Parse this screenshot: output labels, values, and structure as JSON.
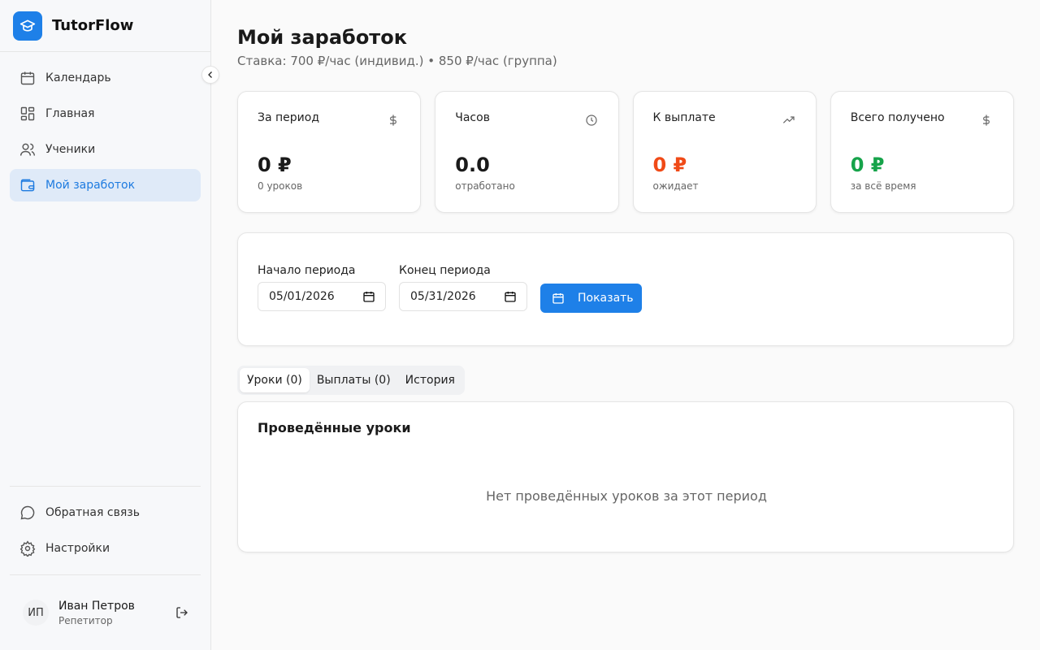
{
  "app": {
    "name": "TutorFlow",
    "brand_color": "#1e80e8"
  },
  "sidebar": {
    "items": [
      {
        "label": "Календарь",
        "icon": "calendar-icon",
        "active": false
      },
      {
        "label": "Главная",
        "icon": "dashboard-icon",
        "active": false
      },
      {
        "label": "Ученики",
        "icon": "users-icon",
        "active": false
      },
      {
        "label": "Мой заработок",
        "icon": "wallet-icon",
        "active": true
      }
    ],
    "bottom_items": [
      {
        "label": "Обратная связь",
        "icon": "message-icon"
      },
      {
        "label": "Настройки",
        "icon": "gear-icon"
      }
    ],
    "user": {
      "initials": "ИП",
      "name": "Иван Петров",
      "role": "Репетитор"
    }
  },
  "header": {
    "title": "Мой заработок",
    "subtitle": "Ставка: 700 ₽/час (индивид.) • 850 ₽/час (группа)"
  },
  "stats": [
    {
      "label": "За период",
      "icon": "dollar-icon",
      "value": "0 ₽",
      "note": "0 уроков",
      "color": "#1a1a1a"
    },
    {
      "label": "Часов",
      "icon": "clock-icon",
      "value": "0.0",
      "note": "отработано",
      "color": "#1a1a1a"
    },
    {
      "label": "К выплате",
      "icon": "trending-up-icon",
      "value": "0 ₽",
      "note": "ожидает",
      "color": "#f04a17"
    },
    {
      "label": "Всего получено",
      "icon": "dollar-icon",
      "value": "0 ₽",
      "note": "за всё время",
      "color": "#16a34a"
    }
  ],
  "filter": {
    "start_label": "Начало периода",
    "start_value": "05/01/2026",
    "end_label": "Конец периода",
    "end_value": "05/31/2026",
    "show_button": "Показать"
  },
  "tabs": [
    {
      "label": "Уроки (0)",
      "active": true
    },
    {
      "label": "Выплаты (0)",
      "active": false
    },
    {
      "label": "История",
      "active": false
    }
  ],
  "lessons": {
    "title": "Проведённые уроки",
    "empty_message": "Нет проведённых уроков за этот период"
  }
}
